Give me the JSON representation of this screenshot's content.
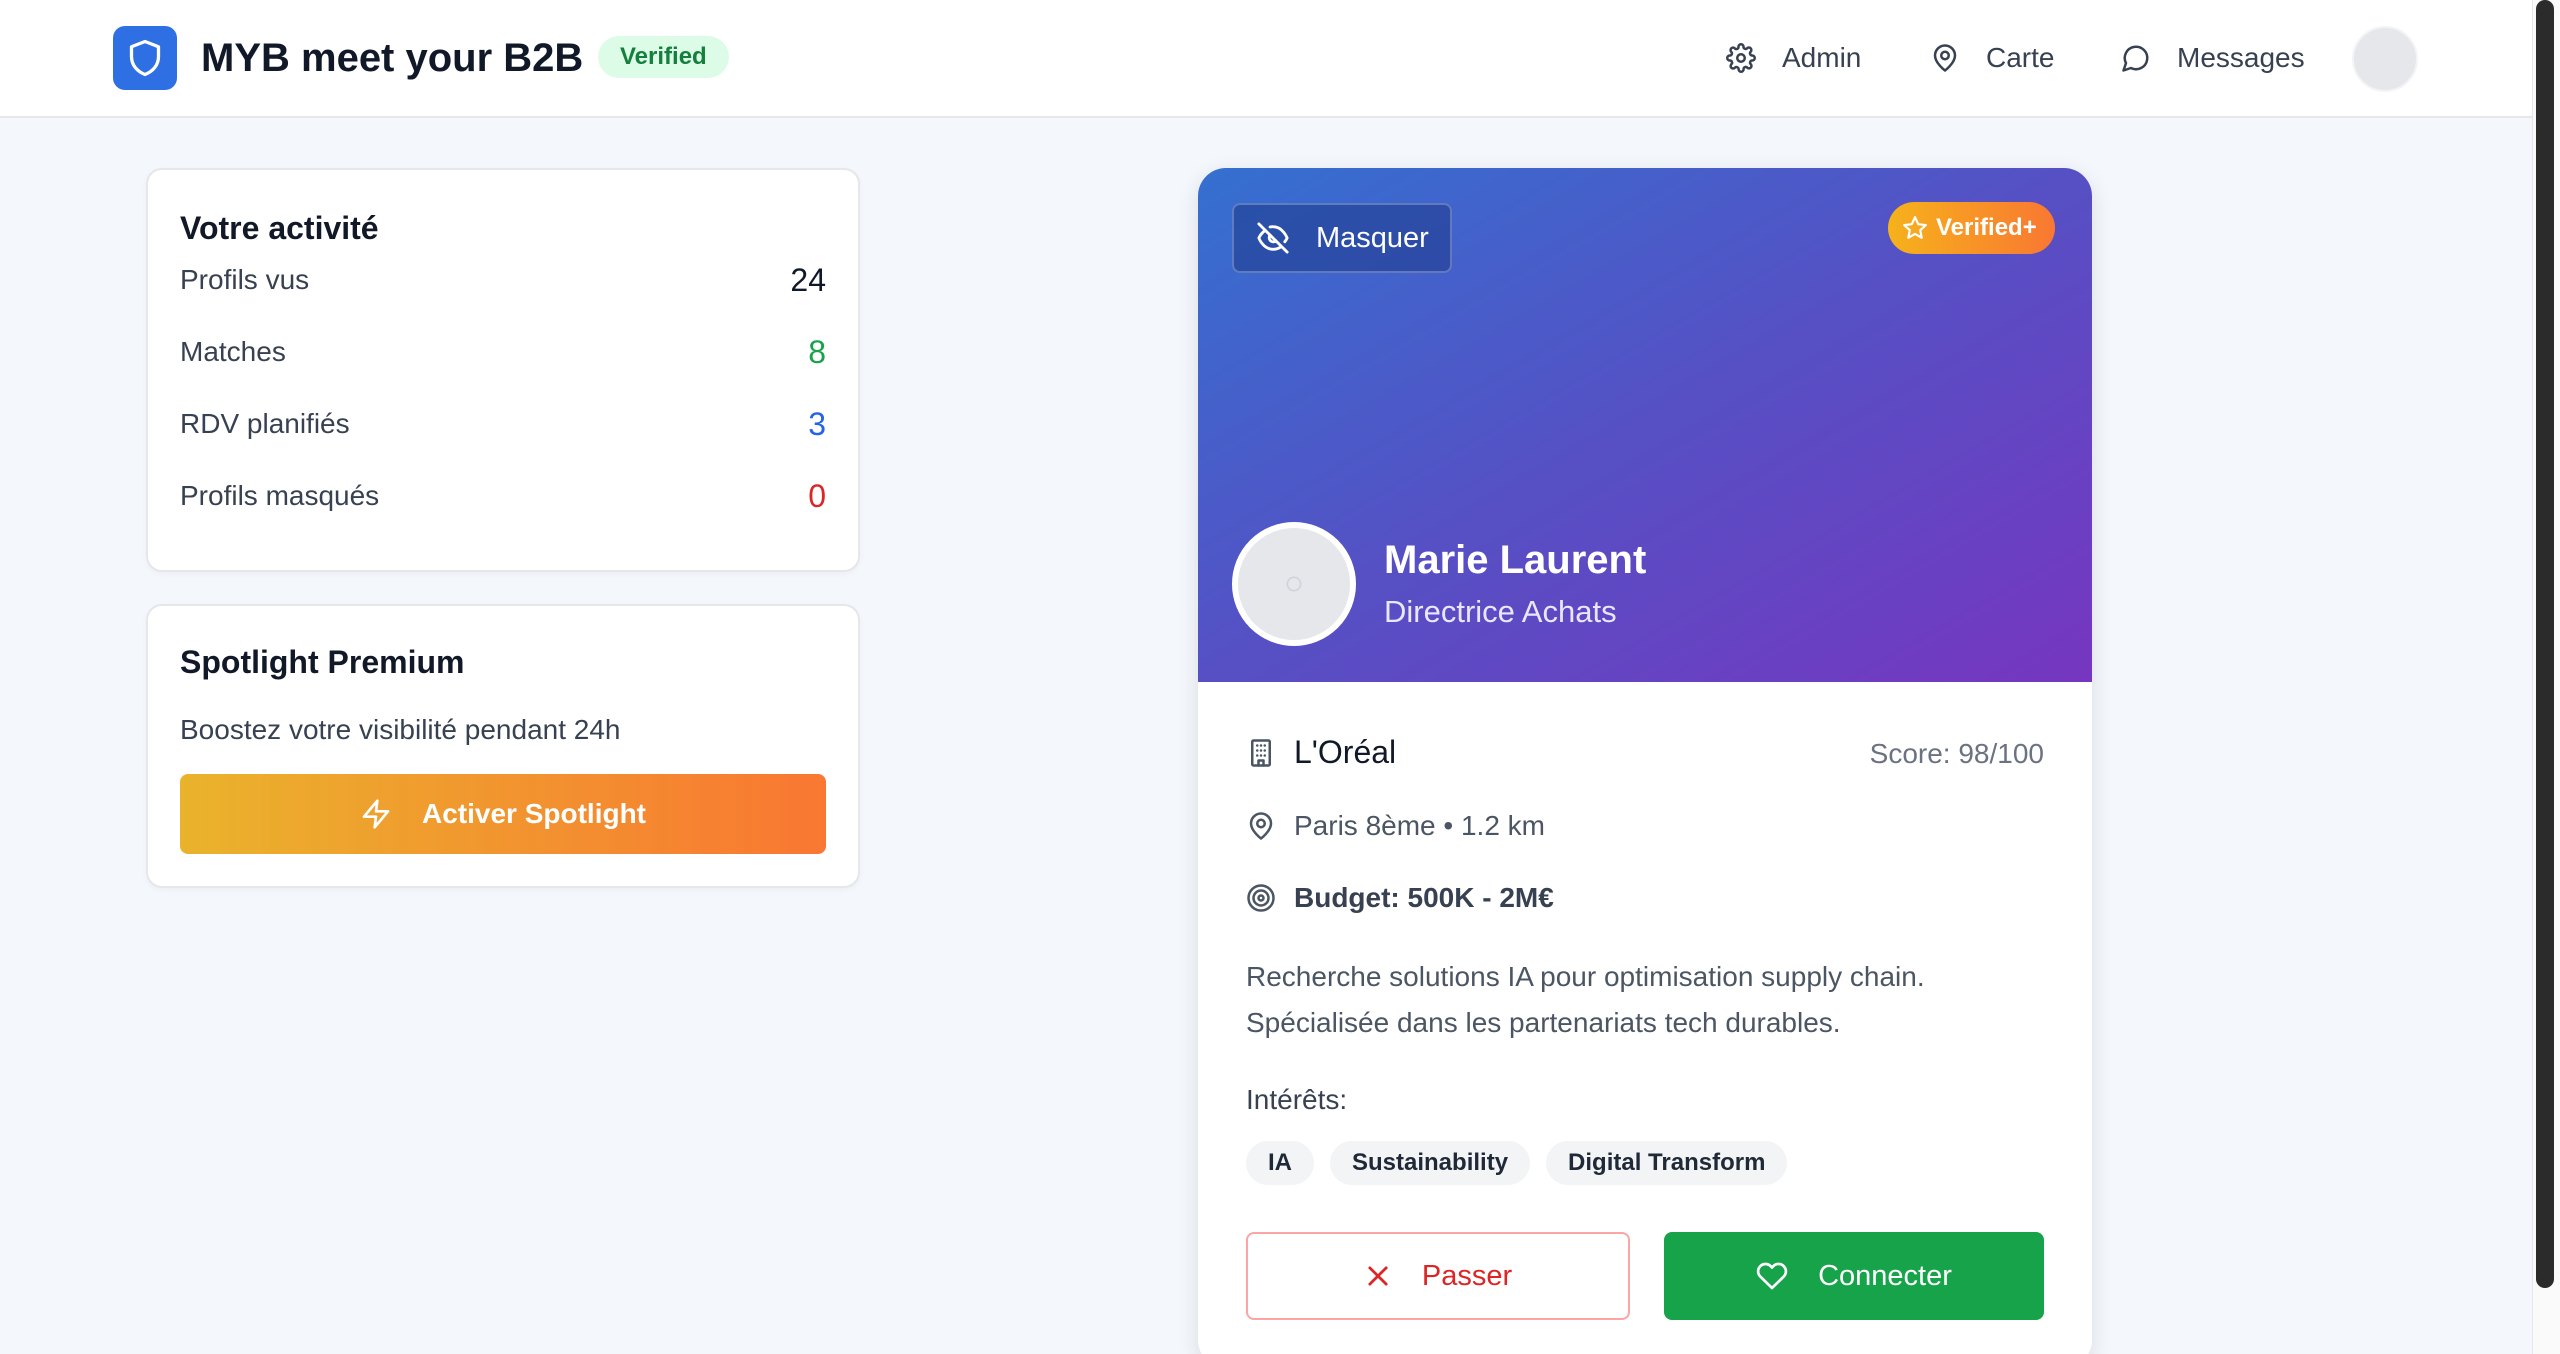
{
  "header": {
    "app_title": "MYB meet your B2B",
    "verified_label": "Verified",
    "nav": {
      "admin": "Admin",
      "carte": "Carte",
      "messages": "Messages"
    }
  },
  "activity": {
    "title": "Votre activité",
    "stats": [
      {
        "label": "Profils vus",
        "value": "24",
        "color": "#111827"
      },
      {
        "label": "Matches",
        "value": "8",
        "color": "#16a34a"
      },
      {
        "label": "RDV planifiés",
        "value": "3",
        "color": "#2563eb"
      },
      {
        "label": "Profils masqués",
        "value": "0",
        "color": "#dc2626"
      }
    ]
  },
  "spotlight": {
    "title": "Spotlight Premium",
    "description": "Boostez votre visibilité pendant 24h",
    "button_label": "Activer Spotlight"
  },
  "profile": {
    "hide_label": "Masquer",
    "badge": "Verified+",
    "name": "Marie Laurent",
    "role": "Directrice Achats",
    "company": "L'Oréal",
    "score": "Score: 98/100",
    "location": "Paris 8ème • 1.2 km",
    "budget": "Budget: 500K - 2M€",
    "description": "Recherche solutions IA pour optimisation supply chain. Spécialisée dans les partenariats tech durables.",
    "interests_label": "Intérêts:",
    "interests": [
      "IA",
      "Sustainability",
      "Digital Transform"
    ],
    "pass_label": "Passer",
    "connect_label": "Connecter"
  },
  "colors": {
    "brand": "#2f6fe4",
    "success": "#16a34a",
    "danger": "#dc2626",
    "hero_start": "#3470d0",
    "hero_end": "#7636c0"
  }
}
